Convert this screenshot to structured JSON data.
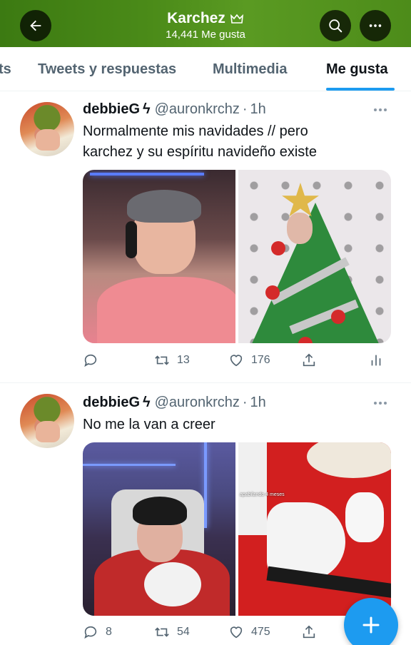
{
  "header": {
    "title": "Karchez",
    "subtitle": "14,441 Me gusta",
    "back_icon": "arrow-left-icon",
    "search_icon": "search-icon",
    "more_icon": "more-horizontal-icon",
    "title_icon": "lock-icon"
  },
  "tabs": {
    "items": [
      {
        "label": "ts"
      },
      {
        "label": "Tweets y respuestas"
      },
      {
        "label": "Multimedia"
      },
      {
        "label": "Me gusta"
      }
    ],
    "active_index": 3,
    "accent": "#1d9bf0"
  },
  "tweets": [
    {
      "name": "debbieG",
      "bolt": "ϟ",
      "handle": "@auronkrchz",
      "dot": "·",
      "time": "1h",
      "text_lines": [
        "Normalmente mis navidades // pero",
        "karchez y su espíritu navideño existe"
      ],
      "media": [
        "photo-streamer-pink-shirt",
        "photo-christmas-tree-costume"
      ],
      "replies": "",
      "retweets": "13",
      "likes": "176"
    },
    {
      "name": "debbieG",
      "bolt": "ϟ",
      "handle": "@auronkrchz",
      "dot": "·",
      "time": "1h",
      "text_lines": [
        "No me la van a creer"
      ],
      "media": [
        "photo-streamer-with-dog",
        "photo-santa-costume"
      ],
      "media_overlay_text": "apabilando 4 meses",
      "replies": "8",
      "retweets": "54",
      "likes": "475"
    }
  ],
  "fab": {
    "icon": "compose-plus-icon",
    "color": "#1d9bf0"
  },
  "colors": {
    "header_green": "#4a8a18",
    "text_primary": "#0f1419",
    "text_secondary": "#536471"
  }
}
